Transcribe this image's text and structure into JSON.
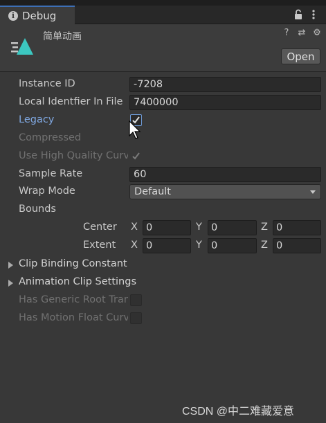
{
  "window": {
    "tab_title": "Debug"
  },
  "header": {
    "asset_name": "简单动画",
    "open_label": "Open"
  },
  "fields": {
    "instance_id": {
      "label": "Instance ID",
      "value": "-7208"
    },
    "local_id": {
      "label": "Local Identfier In File",
      "value": "7400000"
    },
    "legacy": {
      "label": "Legacy",
      "checked": true
    },
    "compressed": {
      "label": "Compressed"
    },
    "high_quality": {
      "label": "Use High Quality Curve",
      "checked": true
    },
    "sample_rate": {
      "label": "Sample Rate",
      "value": "60"
    },
    "wrap_mode": {
      "label": "Wrap Mode",
      "value": "Default"
    },
    "bounds": {
      "label": "Bounds",
      "center": {
        "label": "Center",
        "x": "0",
        "y": "0",
        "z": "0"
      },
      "extent": {
        "label": "Extent",
        "x": "0",
        "y": "0",
        "z": "0"
      },
      "axes": {
        "x": "X",
        "y": "Y",
        "z": "Z"
      }
    },
    "clip_binding": {
      "label": "Clip Binding Constant"
    },
    "anim_settings": {
      "label": "Animation Clip Settings"
    },
    "has_generic_root": {
      "label": "Has Generic Root Transform"
    },
    "has_motion_float": {
      "label": "Has Motion Float Curves"
    }
  },
  "watermark": "CSDN @中二难藏爱意",
  "colors": {
    "accent": "#3d6fb5",
    "legacy_label": "#7fa7e0",
    "icon_teal": "#3cc7c0"
  }
}
